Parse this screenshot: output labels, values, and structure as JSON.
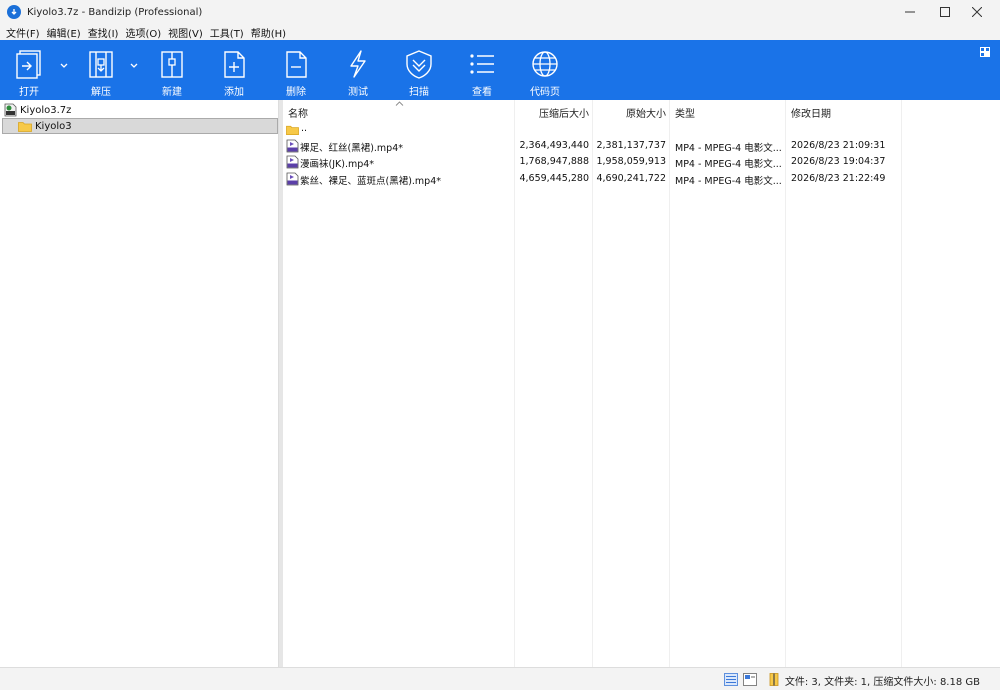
{
  "window": {
    "title": "Kiyolo3.7z - Bandizip (Professional)",
    "controls": [
      "minimize",
      "maximize",
      "close"
    ]
  },
  "menu": [
    {
      "label": "文件(F)"
    },
    {
      "label": "编辑(E)"
    },
    {
      "label": "查找(I)"
    },
    {
      "label": "选项(O)"
    },
    {
      "label": "视图(V)"
    },
    {
      "label": "工具(T)"
    },
    {
      "label": "帮助(H)"
    }
  ],
  "toolbar": {
    "open": "打开",
    "extract": "解压",
    "new": "新建",
    "add": "添加",
    "delete": "删除",
    "test": "测试",
    "scan": "扫描",
    "view": "查看",
    "codepage": "代码页",
    "accent_color": "#1a73e8"
  },
  "tree": {
    "root": "Kiyolo3.7z",
    "child": "Kiyolo3"
  },
  "columns": {
    "name": "名称",
    "packed": "压缩后大小",
    "original": "原始大小",
    "type": "类型",
    "modified": "修改日期"
  },
  "files": {
    "parent": "..",
    "rows": [
      {
        "name": "裸足、红丝(黑裙).mp4*",
        "packed": "2,364,493,440",
        "original": "2,381,137,737",
        "type": "MP4 - MPEG-4 电影文...",
        "modified": "2026/8/23 21:09:31"
      },
      {
        "name": "漫画袜(JK).mp4*",
        "packed": "1,768,947,888",
        "original": "1,958,059,913",
        "type": "MP4 - MPEG-4 电影文...",
        "modified": "2026/8/23 19:04:37"
      },
      {
        "name": "紫丝、裸足、蓝斑点(黑裙).mp4*",
        "packed": "4,659,445,280",
        "original": "4,690,241,722",
        "type": "MP4 - MPEG-4 电影文...",
        "modified": "2026/8/23 21:22:49"
      }
    ]
  },
  "status": {
    "text": "文件: 3, 文件夹: 1, 压缩文件大小: 8.18 GB"
  }
}
